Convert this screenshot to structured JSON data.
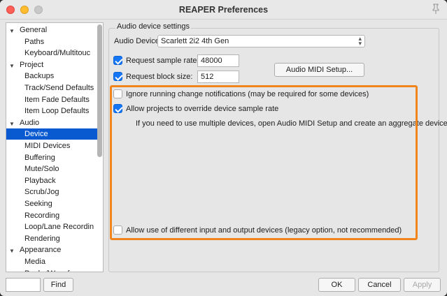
{
  "window": {
    "title": "REAPER Preferences"
  },
  "tree": {
    "items": [
      {
        "label": "General",
        "level": "top",
        "expanded": true
      },
      {
        "label": "Paths",
        "level": "child"
      },
      {
        "label": "Keyboard/Multitouc",
        "level": "child"
      },
      {
        "label": "Project",
        "level": "top",
        "expanded": true
      },
      {
        "label": "Backups",
        "level": "child"
      },
      {
        "label": "Track/Send Defaults",
        "level": "child"
      },
      {
        "label": "Item Fade Defaults",
        "level": "child"
      },
      {
        "label": "Item Loop Defaults",
        "level": "child"
      },
      {
        "label": "Audio",
        "level": "top",
        "expanded": true
      },
      {
        "label": "Device",
        "level": "child",
        "selected": true
      },
      {
        "label": "MIDI Devices",
        "level": "child"
      },
      {
        "label": "Buffering",
        "level": "child"
      },
      {
        "label": "Mute/Solo",
        "level": "child"
      },
      {
        "label": "Playback",
        "level": "child"
      },
      {
        "label": "Scrub/Jog",
        "level": "child"
      },
      {
        "label": "Seeking",
        "level": "child"
      },
      {
        "label": "Recording",
        "level": "child"
      },
      {
        "label": "Loop/Lane Recordin",
        "level": "child"
      },
      {
        "label": "Rendering",
        "level": "child"
      },
      {
        "label": "Appearance",
        "level": "top",
        "expanded": true
      },
      {
        "label": "Media",
        "level": "child"
      },
      {
        "label": "Peaks/Waveforms",
        "level": "child"
      }
    ]
  },
  "bottom": {
    "find_value": "",
    "find_label": "Find",
    "ok_label": "OK",
    "cancel_label": "Cancel",
    "apply_label": "Apply"
  },
  "settings": {
    "group_title": "Audio device settings",
    "device_label": "Audio Device:",
    "device_value": "Scarlett 2i2 4th Gen",
    "request_rate_label": "Request sample rate:",
    "request_rate_checked": true,
    "request_rate_value": "48000",
    "request_block_label": "Request block size:",
    "request_block_checked": true,
    "request_block_value": "512",
    "midi_setup_label": "Audio MIDI Setup...",
    "ignore_label": "Ignore running change notifications (may be required for some devices)",
    "ignore_checked": false,
    "allow_override_label": "Allow projects to override device sample rate",
    "allow_override_checked": true,
    "info_text": "If you need to use multiple devices, open Audio MIDI Setup and create an aggregate device.",
    "legacy_label": "Allow use of different input and output devices (legacy option, not recommended)",
    "legacy_checked": false
  },
  "colors": {
    "accent": "#1476f5",
    "selection": "#0959d0",
    "highlight_box": "#f0851e"
  }
}
